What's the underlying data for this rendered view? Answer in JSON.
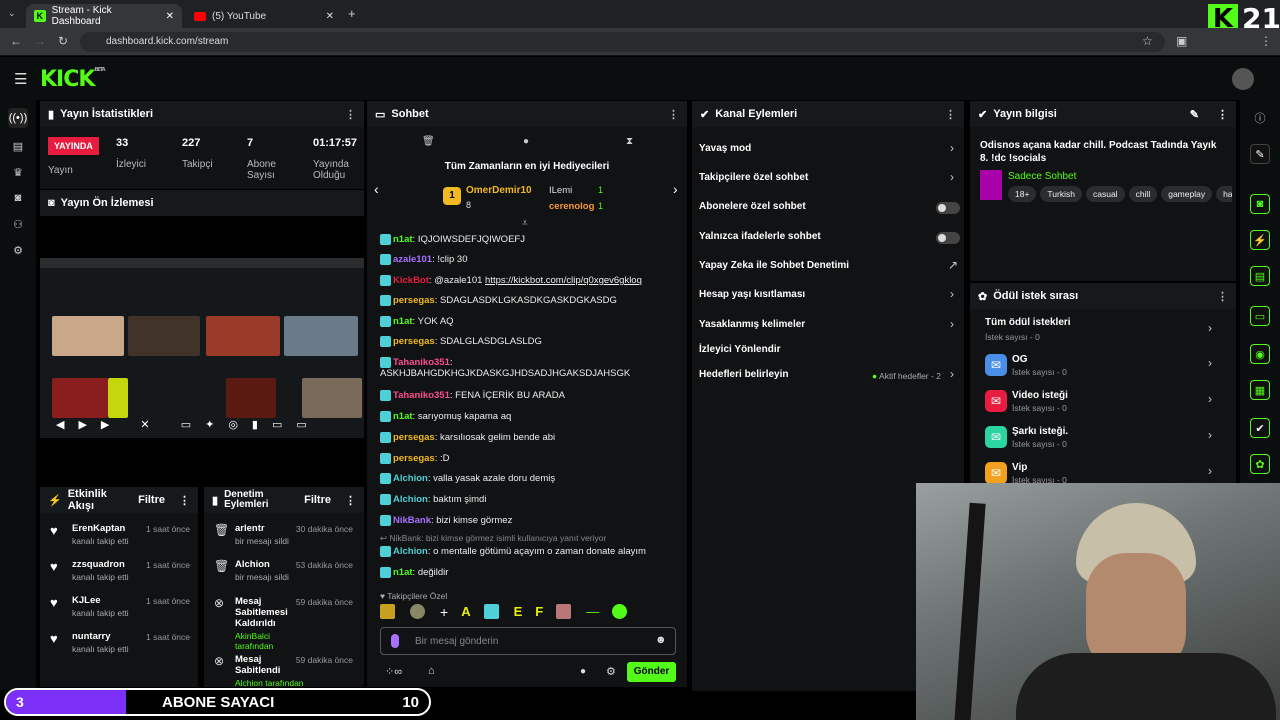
{
  "browser": {
    "tabs": [
      {
        "label": "Stream - Kick Dashboard"
      },
      {
        "label": "(5) YouTube"
      }
    ],
    "url": "dashboard.kick.com/stream"
  },
  "overlay_logo": "21",
  "header": {
    "logo": "KICK",
    "logo_sup": "BETA"
  },
  "stats": {
    "title": "Yayın İstatistikleri",
    "live_badge": "YAYINDA",
    "live_label": "Yayın",
    "viewers": "33",
    "viewers_label": "İzleyici",
    "followers": "227",
    "followers_label": "Takipçi",
    "subs": "7",
    "subs_label": "Abone Sayısı",
    "uptime": "01:17:57",
    "uptime_label": "Yayında Olduğu"
  },
  "preview": {
    "title": "Yayın Ön İzlemesi"
  },
  "chat": {
    "title": "Sohbet",
    "gifters_title": "Tüm Zamanların en iyi Hediyecileri",
    "top1": {
      "name": "OmerDemir10",
      "count": "8"
    },
    "top2": {
      "name": "ILemi",
      "count": "1"
    },
    "top3": {
      "name": "cerenolog",
      "count": "1"
    },
    "messages": [
      {
        "user": "n1at",
        "color": "#53fc18",
        "text": "IQJOIWSDEFJQIWOEFJ"
      },
      {
        "user": "azale101",
        "color": "#a970ff",
        "text": "!clip 30"
      },
      {
        "user": "KickBot",
        "color": "#e81c3f",
        "text": "@azale101 ",
        "link": "https://kickbot.com/clip/q0xgev6gkloq"
      },
      {
        "user": "persegas",
        "color": "#f1b91f",
        "text": "SDAGLASDKLGKASDKGASKDGKASDG"
      },
      {
        "user": "n1at",
        "color": "#53fc18",
        "text": "YOK AQ"
      },
      {
        "user": "persegas",
        "color": "#f1b91f",
        "text": "SDALGLASDGLASLDG"
      },
      {
        "user": "Tahaniko351",
        "color": "#ff4f8b",
        "text": "ASKHJBAHGDKHGJKDASKGJHDSADJHGAKSDJAHSGK"
      },
      {
        "user": "Tahaniko351",
        "color": "#ff4f8b",
        "text": "FENA İÇERİK BU ARADA"
      },
      {
        "user": "n1at",
        "color": "#53fc18",
        "text": "sarıyomuş kapama aq"
      },
      {
        "user": "persegas",
        "color": "#f1b91f",
        "text": "karsılıosak gelim bende abi"
      },
      {
        "user": "persegas",
        "color": "#f1b91f",
        "text": ":D"
      },
      {
        "user": "Alchion",
        "color": "#4ed0d6",
        "text": "valla yasak azale doru demiş"
      },
      {
        "user": "Alchion",
        "color": "#4ed0d6",
        "text": "baktım şimdi"
      },
      {
        "user": "NikBank",
        "color": "#a970ff",
        "text": "bizi kimse görmez"
      },
      {
        "reply": "NikBank: bizi kimse görmez isimli kullanıcıya yanıt veriyor"
      },
      {
        "user": "Alchion",
        "color": "#4ed0d6",
        "text": "o mentalle götümü açayım o zaman donate alayım"
      },
      {
        "user": "n1at",
        "color": "#53fc18",
        "text": "değildir"
      }
    ],
    "mode_label": "Takipçilere Özel",
    "input_placeholder": "Bir mesaj gönderin",
    "send_label": "Gönder"
  },
  "channel_actions": {
    "title": "Kanal Eylemleri",
    "items": [
      "Yavaş mod",
      "Takipçilere özel sohbet",
      "Abonelere özel sohbet",
      "Yalnızca ifadelerle sohbet",
      "Yapay Zeka ile Sohbet Denetimi",
      "Hesap yaşı kısıtlaması",
      "Yasaklanmış kelimeler",
      "İzleyici Yönlendir",
      "Hedefleri belirleyin"
    ],
    "goals_status": "Aktif hedefler - 2"
  },
  "stream_info": {
    "title": "Yayın bilgisi",
    "stream_title": "Odisnos açana kadar chill. Podcast Tadında Yayık 8. !dc !socials",
    "category": "Sadece Sohbet",
    "tags": [
      "18+",
      "Turkish",
      "casual",
      "chill",
      "gameplay",
      "ha"
    ]
  },
  "rewards": {
    "title": "Ödül istek sırası",
    "all_label": "Tüm ödül istekleri",
    "count_label": "İstek sayısı - 0",
    "items": [
      {
        "name": "OG",
        "count": "İstek sayısı - 0",
        "color": "#4a8fe7"
      },
      {
        "name": "Video isteği",
        "count": "İstek sayısı - 0",
        "color": "#e81c3f"
      },
      {
        "name": "Şarkı isteği.",
        "count": "İstek sayısı - 0",
        "color": "#2bd4a0"
      },
      {
        "name": "Vip",
        "count": "İstek sayısı - 0",
        "color": "#f1a11f"
      }
    ]
  },
  "events": {
    "title": "Etkinlik Akışı",
    "filter": "Filtre",
    "items": [
      {
        "name": "ErenKaptan",
        "desc": "kanalı takip etti",
        "time": "1 saat önce"
      },
      {
        "name": "zzsquadron",
        "desc": "kanalı takip etti",
        "time": "1 saat önce"
      },
      {
        "name": "KJLee",
        "desc": "kanalı takip etti",
        "time": "1 saat önce"
      },
      {
        "name": "nuntarry",
        "desc": "kanalı takip etti",
        "time": "1 saat önce"
      }
    ]
  },
  "deleted": {
    "title": "Denetim Eylemleri",
    "filter": "Filtre",
    "items": [
      {
        "name": "arlentr",
        "desc": "bir mesajı sildi",
        "time": "30 dakika önce"
      },
      {
        "name": "Alchion",
        "desc": "bir mesajı sildi",
        "time": "53 dakika önce"
      },
      {
        "name": "Mesaj Sabitlemesi Kaldırıldı",
        "desc": "AkinBalci tarafından",
        "time": "59 dakika önce"
      },
      {
        "name": "Mesaj Sabitlendi",
        "desc": "Alchion tarafından",
        "time": "59 dakika önce"
      }
    ]
  },
  "sub_counter": {
    "left": "3",
    "label": "ABONE SAYACI",
    "right": "10"
  }
}
